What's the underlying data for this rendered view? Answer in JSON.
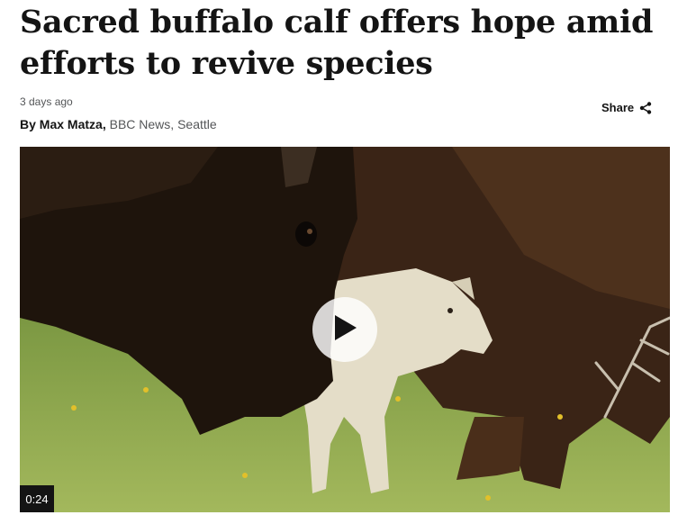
{
  "article": {
    "headline": "Sacred buffalo calf offers hope amid efforts to revive species",
    "timestamp": "3 days ago",
    "byline": {
      "prefix": "By ",
      "author": "Max Matza",
      "separator": ",",
      "outlet": "BBC News",
      "location": "Seattle"
    },
    "share_label": "Share"
  },
  "media": {
    "duration": "0:24",
    "play_icon": "play-icon"
  },
  "colors": {
    "text": "#141414",
    "muted": "#545658",
    "grass": "#7a9a40",
    "bison": "#2a1a10",
    "calf": "#e8e2cf"
  }
}
